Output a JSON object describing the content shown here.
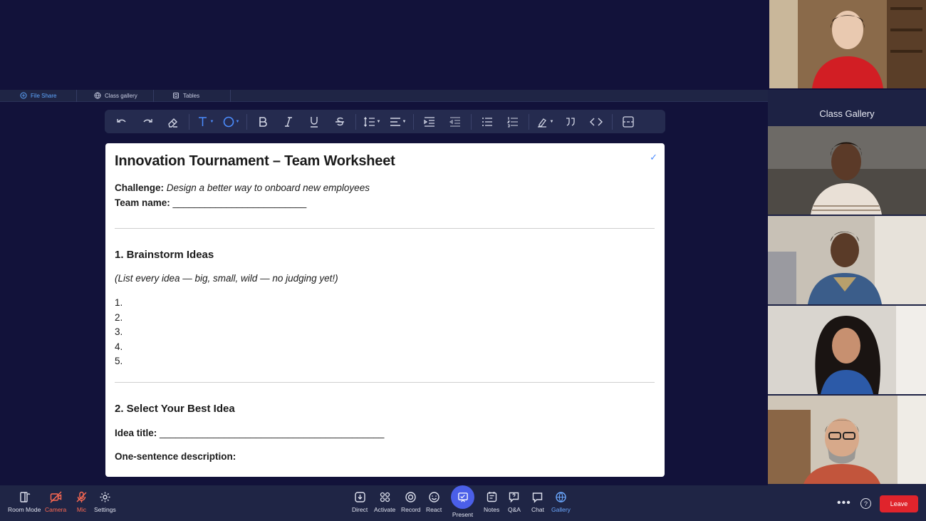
{
  "tabs": [
    {
      "label": "File Share",
      "icon": "file-share-icon",
      "active": true
    },
    {
      "label": "Class gallery",
      "icon": "globe-icon",
      "active": false
    },
    {
      "label": "Tables",
      "icon": "tables-icon",
      "active": false
    }
  ],
  "toolbar": {
    "tools": [
      "undo-icon",
      "redo-icon",
      "eraser-icon",
      "text-color-icon",
      "fill-color-icon",
      "bold-icon",
      "italic-icon",
      "underline-icon",
      "strikethrough-icon",
      "line-height-icon",
      "align-icon",
      "indent-icon",
      "outdent-icon",
      "bullet-list-icon",
      "numbered-list-icon",
      "highlight-icon",
      "quote-icon",
      "code-icon",
      "page-break-icon"
    ]
  },
  "document": {
    "title": "Innovation Tournament – Team Worksheet",
    "challenge_label": "Challenge:",
    "challenge_value": "Design a better way to onboard new employees",
    "team_label": "Team name:",
    "team_blank": "_________________________",
    "section1_title": "1. Brainstorm Ideas",
    "section1_hint": "(List every idea — big, small, wild — no judging yet!)",
    "list": [
      "1.",
      "2.",
      "3.",
      "4.",
      "5."
    ],
    "section2_title": "2. Select Your Best Idea",
    "idea_label": "Idea title:",
    "idea_blank": "__________________________________________",
    "desc_label": "One-sentence description:"
  },
  "gallery": {
    "title": "Class Gallery"
  },
  "bottom": {
    "left": [
      {
        "label": "Room Mode",
        "icon": "room-mode-icon"
      },
      {
        "label": "Camera",
        "icon": "camera-off-icon"
      },
      {
        "label": "Mic",
        "icon": "mic-off-icon"
      },
      {
        "label": "Settings",
        "icon": "gear-icon"
      }
    ],
    "center": [
      {
        "label": "Direct",
        "icon": "direct-icon"
      },
      {
        "label": "Activate",
        "icon": "activate-icon"
      },
      {
        "label": "Record",
        "icon": "record-icon"
      },
      {
        "label": "React",
        "icon": "react-icon"
      },
      {
        "label": "Present",
        "icon": "present-icon"
      },
      {
        "label": "Notes",
        "icon": "notes-icon"
      },
      {
        "label": "Q&A",
        "icon": "qa-icon"
      },
      {
        "label": "Chat",
        "icon": "chat-icon"
      },
      {
        "label": "Gallery",
        "icon": "gallery-icon"
      }
    ],
    "more": "•••",
    "help": "?",
    "leave": "Leave"
  },
  "colors": {
    "background": "#12123a",
    "accent": "#4c8dff",
    "leave": "#e0242c",
    "muted_red": "#ff6a52"
  }
}
